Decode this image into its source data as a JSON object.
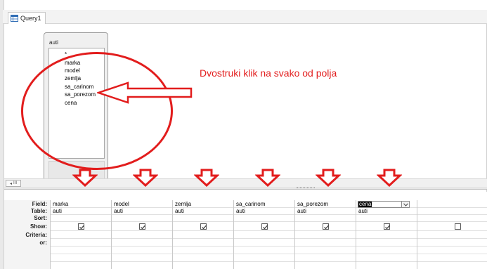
{
  "tab": {
    "title": "Query1",
    "icon": "query-design-icon"
  },
  "table": {
    "name": "auti",
    "fields": [
      "*",
      "marka",
      "model",
      "zemlja",
      "sa_carinom",
      "sa_porezom",
      "cena"
    ]
  },
  "annotation": {
    "text": "Dvostruki klik na svako od polja",
    "color": "#e21d1d"
  },
  "grid": {
    "row_labels": [
      "Field:",
      "Table:",
      "Sort:",
      "Show:",
      "Criteria:",
      "or:"
    ],
    "columns": [
      {
        "field": "marka",
        "table": "auti",
        "show": true
      },
      {
        "field": "model",
        "table": "auti",
        "show": true
      },
      {
        "field": "zemlja",
        "table": "auti",
        "show": true
      },
      {
        "field": "sa_carinom",
        "table": "auti",
        "show": true
      },
      {
        "field": "sa_porezom",
        "table": "auti",
        "show": true
      },
      {
        "field": "cena",
        "table": "auti",
        "show": true,
        "selected": true
      },
      {
        "field": "",
        "table": "",
        "show": false
      }
    ]
  },
  "scrollbar": {
    "label": "III"
  }
}
